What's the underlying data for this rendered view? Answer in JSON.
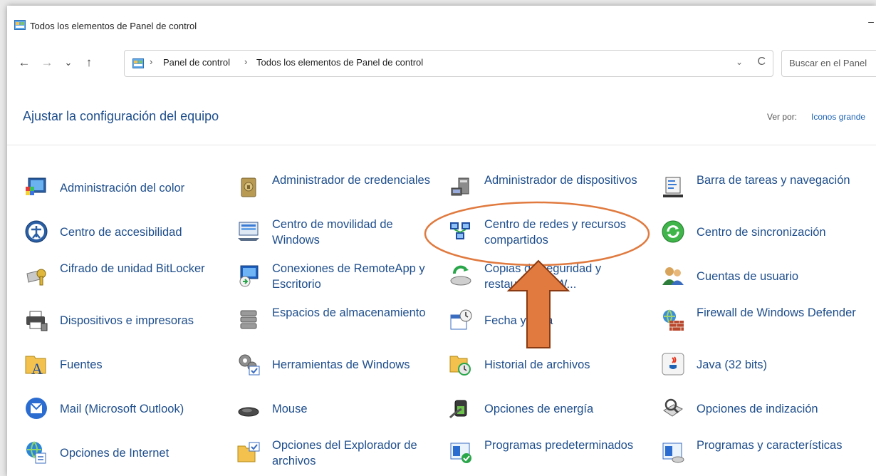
{
  "window": {
    "title": "Todos los elementos de Panel de control"
  },
  "address": {
    "crumb1": "Panel de control",
    "crumb2": "Todos los elementos de Panel de control",
    "dropdown": "⌄",
    "refresh": "C"
  },
  "search": {
    "placeholder": "Buscar en el Panel"
  },
  "nav": {
    "back": "←",
    "forward": "→",
    "recent": "⌄",
    "up": "↑"
  },
  "heading": "Ajustar la configuración del equipo",
  "view_by": {
    "label": "Ver por:",
    "value": "Iconos grande"
  },
  "items": [
    {
      "label": "Administración del color",
      "icon": "color-management-icon"
    },
    {
      "label": "Administrador de credenciales",
      "icon": "credential-manager-icon"
    },
    {
      "label": "Administrador de dispositivos",
      "icon": "device-manager-icon"
    },
    {
      "label": "Barra de tareas y navegación",
      "icon": "taskbar-icon"
    },
    {
      "label": "Centro de accesibilidad",
      "icon": "accessibility-icon"
    },
    {
      "label": "Centro de movilidad de Windows",
      "icon": "mobility-center-icon"
    },
    {
      "label": "Centro de redes y recursos compartidos",
      "icon": "network-center-icon"
    },
    {
      "label": "Centro de sincronización",
      "icon": "sync-center-icon"
    },
    {
      "label": "Cifrado de unidad BitLocker",
      "icon": "bitlocker-icon"
    },
    {
      "label": "Conexiones de RemoteApp y Escritorio",
      "icon": "remoteapp-icon"
    },
    {
      "label": "Copias de seguridad y restauración (W...",
      "icon": "backup-icon"
    },
    {
      "label": "Cuentas de usuario",
      "icon": "user-accounts-icon"
    },
    {
      "label": "Dispositivos e impresoras",
      "icon": "printer-icon"
    },
    {
      "label": "Espacios de almacenamiento",
      "icon": "storage-spaces-icon"
    },
    {
      "label": "Fecha y hora",
      "icon": "date-time-icon"
    },
    {
      "label": "Firewall de Windows Defender",
      "icon": "firewall-icon"
    },
    {
      "label": "Fuentes",
      "icon": "fonts-icon"
    },
    {
      "label": "Herramientas de Windows",
      "icon": "windows-tools-icon"
    },
    {
      "label": "Historial de archivos",
      "icon": "file-history-icon"
    },
    {
      "label": "Java (32 bits)",
      "icon": "java-icon"
    },
    {
      "label": "Mail (Microsoft Outlook)",
      "icon": "mail-icon"
    },
    {
      "label": "Mouse",
      "icon": "mouse-icon"
    },
    {
      "label": "Opciones de energía",
      "icon": "power-options-icon"
    },
    {
      "label": "Opciones de indización",
      "icon": "indexing-options-icon"
    },
    {
      "label": "Opciones de Internet",
      "icon": "internet-options-icon"
    },
    {
      "label": "Opciones del Explorador de archivos",
      "icon": "explorer-options-icon"
    },
    {
      "label": "Programas predeterminados",
      "icon": "default-programs-icon"
    },
    {
      "label": "Programas y características",
      "icon": "programs-features-icon"
    }
  ],
  "colors": {
    "link": "#1e4e8c",
    "highlight": "#e07a3f"
  }
}
